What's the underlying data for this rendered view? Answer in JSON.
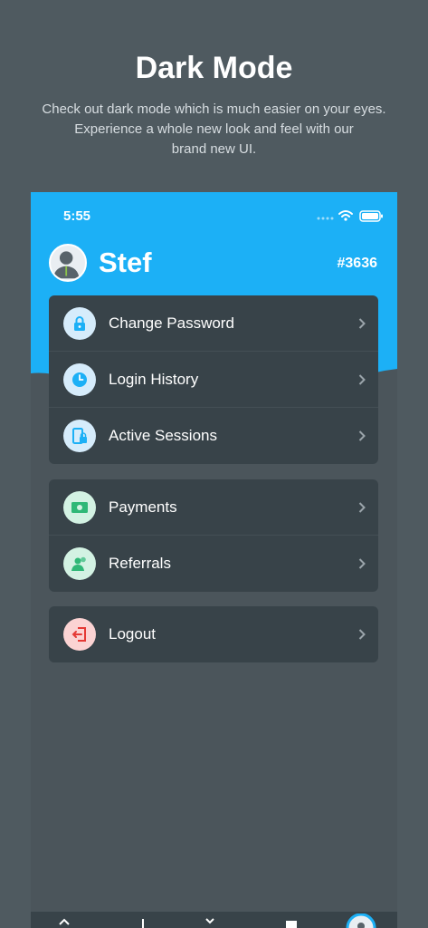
{
  "promo": {
    "title": "Dark Mode",
    "description_line1": "Check out dark mode which is much easier on your eyes.",
    "description_line2": "Experience a whole new look and feel with our",
    "description_line3": "brand new UI."
  },
  "status_bar": {
    "time": "5:55"
  },
  "profile": {
    "name": "Stef",
    "id": "#3636"
  },
  "menu_groups": [
    [
      {
        "label": "Change Password",
        "icon": "lock-icon",
        "icon_bg": "#d6ecfb",
        "icon_color": "#1cb0f6"
      },
      {
        "label": "Login History",
        "icon": "clock-icon",
        "icon_bg": "#d6ecfb",
        "icon_color": "#1cb0f6"
      },
      {
        "label": "Active Sessions",
        "icon": "device-lock-icon",
        "icon_bg": "#d6ecfb",
        "icon_color": "#1cb0f6"
      }
    ],
    [
      {
        "label": "Payments",
        "icon": "cash-icon",
        "icon_bg": "#d3f2e3",
        "icon_color": "#2fb877"
      },
      {
        "label": "Referrals",
        "icon": "users-icon",
        "icon_bg": "#d3f2e3",
        "icon_color": "#2fb877"
      }
    ],
    [
      {
        "label": "Logout",
        "icon": "logout-icon",
        "icon_bg": "#fbd3d3",
        "icon_color": "#e53935"
      }
    ]
  ],
  "colors": {
    "accent": "#1cb0f6",
    "background": "#4f5a60",
    "card": "#384349"
  }
}
